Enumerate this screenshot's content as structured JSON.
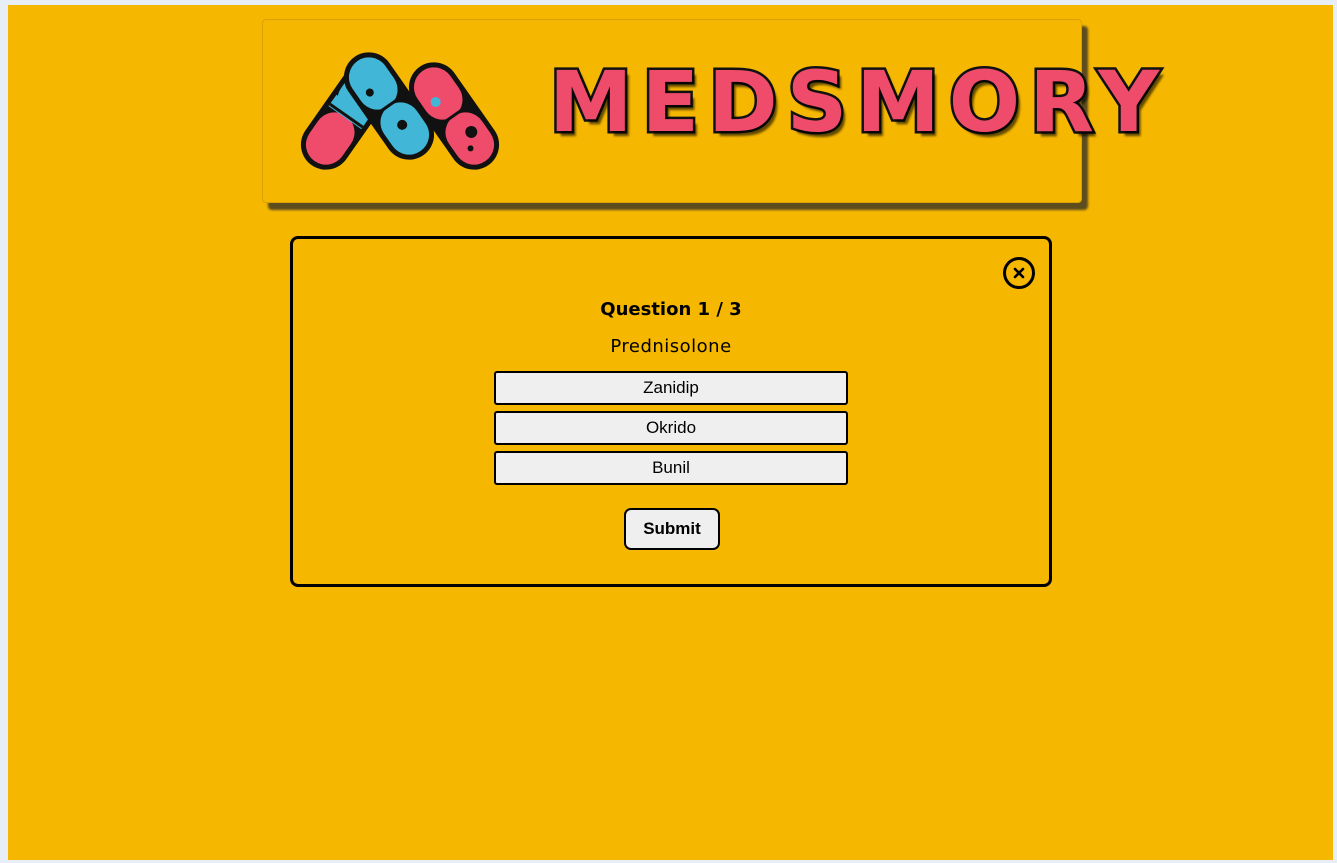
{
  "app": {
    "brand_name": "MEDSMORY"
  },
  "colors": {
    "background": "#f5b700",
    "pill_pink": "#ef4b6b",
    "pill_blue": "#42b6d6",
    "outline": "#111111",
    "button_bg": "#efefef"
  },
  "quiz": {
    "close_icon": "close-circle-icon",
    "question_label": "Question 1 / 3",
    "drug_name": "Prednisolone",
    "options": [
      {
        "label": "Zanidip"
      },
      {
        "label": "Okrido"
      },
      {
        "label": "Bunil"
      }
    ],
    "submit_label": "Submit"
  }
}
